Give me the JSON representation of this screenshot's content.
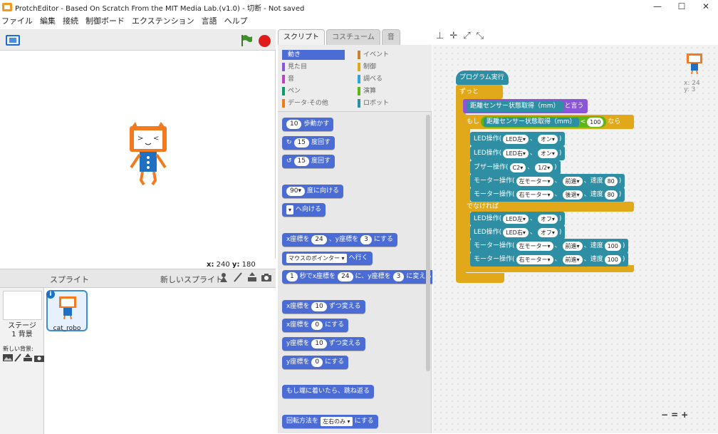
{
  "window": {
    "title": "ProtchEditor - Based On Scratch From the MIT Media Lab.(v1.0) - 切断 - Not saved",
    "minimize": "—",
    "maximize": "☐",
    "close": "✕"
  },
  "menu": [
    "ファイル",
    "編集",
    "接続",
    "制御ボード",
    "エクステンション",
    "言語",
    "ヘルプ"
  ],
  "stage": {
    "x_label": "x:",
    "x": "240",
    "y_label": "y:",
    "y": "180"
  },
  "sprites": {
    "header": "スプライト",
    "new_sprite": "新しいスプライト:",
    "stage_label": "ステージ",
    "stage_bg": "1 背景",
    "new_bg": "新しい背景:",
    "items": [
      {
        "name": "cat_robo"
      }
    ]
  },
  "tabs": [
    "スクリプト",
    "コスチューム",
    "音"
  ],
  "categories": [
    {
      "label": "動き",
      "color": "#4a6cd4"
    },
    {
      "label": "イベント",
      "color": "#c88330"
    },
    {
      "label": "見た目",
      "color": "#8a55d7"
    },
    {
      "label": "制御",
      "color": "#e1a91a"
    },
    {
      "label": "音",
      "color": "#bb42c3"
    },
    {
      "label": "調べる",
      "color": "#2ca5e2"
    },
    {
      "label": "ペン",
      "color": "#0e9a6c"
    },
    {
      "label": "演算",
      "color": "#5cb712"
    },
    {
      "label": "データ·その他",
      "color": "#ee7d16"
    },
    {
      "label": "ロボット",
      "color": "#2e8ea4"
    }
  ],
  "palette": {
    "move": {
      "v": "10",
      "t": "歩動かす"
    },
    "turn_r": {
      "v": "15",
      "t": "度回す"
    },
    "turn_l": {
      "v": "15",
      "t": "度回す"
    },
    "point_dir": {
      "v": "90▾",
      "t": "度に向ける"
    },
    "point_to": {
      "v": "▾",
      "t": "へ向ける"
    },
    "goto_xy": {
      "a": "x座標を",
      "x": "24",
      "b": "、y座標を",
      "y": "3",
      "c": "にする"
    },
    "goto": {
      "v": "マウスのポインター ▾",
      "t": "へ行く"
    },
    "glide": {
      "s": "1",
      "a": "秒でx座標を",
      "x": "24",
      "b": "に、y座標を",
      "y": "3",
      "c": "に変える"
    },
    "change_x": {
      "a": "x座標を",
      "v": "10",
      "b": "ずつ変える"
    },
    "set_x": {
      "a": "x座標を",
      "v": "0",
      "b": "にする"
    },
    "change_y": {
      "a": "y座標を",
      "v": "10",
      "b": "ずつ変える"
    },
    "set_y": {
      "a": "y座標を",
      "v": "0",
      "b": "にする"
    },
    "bounce": {
      "t": "もし端に着いたら、跳ね返る"
    },
    "rotation": {
      "a": "回転方法を",
      "v": "左右のみ ▾",
      "b": "にする"
    }
  },
  "script": {
    "hat": "プログラム実行",
    "forever": "ずっと",
    "say": {
      "reporter": "距離センサー状態取得（mm）",
      "t": "と言う"
    },
    "if": {
      "a": "もし",
      "reporter": "距離センサー状態取得（mm）",
      "op": "<",
      "v": "100",
      "b": "なら"
    },
    "then": [
      {
        "t": "LED操作(",
        "a": "LED左▾",
        "sep": "、",
        "b": "オン▾",
        "end": ")"
      },
      {
        "t": "LED操作(",
        "a": "LED右▾",
        "sep": "、",
        "b": "オン▾",
        "end": ")"
      },
      {
        "t": "ブザー操作(",
        "a": "C2▾",
        "sep": "、",
        "b": "1/2▾",
        "end": ")"
      },
      {
        "t": "モーター操作(",
        "a": "左モーター▾",
        "sep": "、",
        "b": "前進▾",
        "c": "、速度",
        "v": "80",
        "end": ")"
      },
      {
        "t": "モーター操作(",
        "a": "右モーター▾",
        "sep": "、",
        "b": "後退▾",
        "c": "、速度",
        "v": "80",
        "end": ")"
      }
    ],
    "else": "でなければ",
    "else_blocks": [
      {
        "t": "LED操作(",
        "a": "LED左▾",
        "sep": "、",
        "b": "オフ▾",
        "end": ")"
      },
      {
        "t": "LED操作(",
        "a": "LED右▾",
        "sep": "、",
        "b": "オフ▾",
        "end": ")"
      },
      {
        "t": "モーター操作(",
        "a": "左モーター▾",
        "sep": "、",
        "b": "前進▾",
        "c": "、速度",
        "v": "100",
        "end": ")"
      },
      {
        "t": "モーター操作(",
        "a": "右モーター▾",
        "sep": "、",
        "b": "前進▾",
        "c": "、速度",
        "v": "100",
        "end": ")"
      }
    ],
    "sprite_x": "x: 24",
    "sprite_y": "y: 3"
  },
  "zoom": {
    "out": "−",
    "reset": "=",
    "in": "+"
  }
}
